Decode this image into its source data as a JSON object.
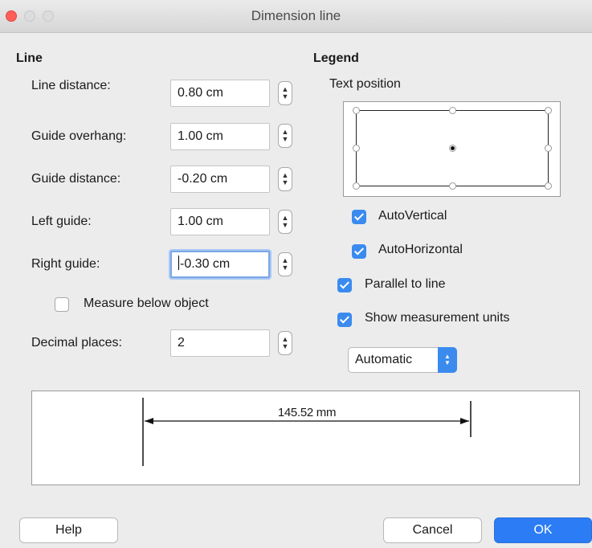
{
  "window": {
    "title": "Dimension line"
  },
  "line": {
    "heading": "Line",
    "rows": [
      {
        "label": "Line distance:",
        "value": "0.80 cm"
      },
      {
        "label": "Guide overhang:",
        "value": "1.00 cm"
      },
      {
        "label": "Guide distance:",
        "value": "-0.20 cm"
      },
      {
        "label": "Left guide:",
        "value": "1.00 cm"
      },
      {
        "label": "Right guide:",
        "value": "-0.30 cm"
      }
    ],
    "measure_below": {
      "label": "Measure below object",
      "checked": false
    },
    "decimal": {
      "label": "Decimal places:",
      "value": "2"
    }
  },
  "legend": {
    "heading": "Legend",
    "text_position_label": "Text position",
    "auto_vertical": {
      "label": "AutoVertical",
      "checked": true
    },
    "auto_horizontal": {
      "label": "AutoHorizontal",
      "checked": true
    },
    "parallel": {
      "label": "Parallel to line",
      "checked": true
    },
    "show_units": {
      "label": "Show measurement units",
      "checked": true
    },
    "unit_select": "Automatic"
  },
  "preview": {
    "measurement": "145.52 mm"
  },
  "buttons": {
    "help": "Help",
    "cancel": "Cancel",
    "ok": "OK"
  },
  "colors": {
    "accent": "#3b8bef",
    "ok_button": "#2c7cf6",
    "close_light": "#ff5f57"
  }
}
